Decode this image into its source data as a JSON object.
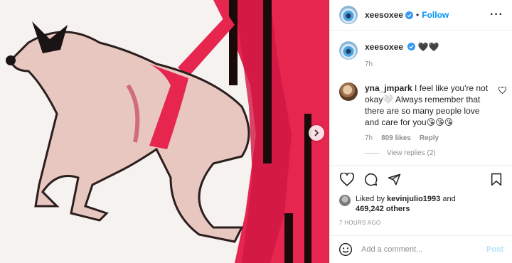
{
  "header": {
    "username": "xeesoxee",
    "separator": "•",
    "follow_label": "Follow",
    "more_label": "···"
  },
  "caption": {
    "username": "xeesoxee",
    "text": "🖤🖤",
    "time": "7h"
  },
  "comment": {
    "username": "yna_jmpark",
    "text": "I feel like you're not okay🤍 Always remember that there are so many people love and care for you😘😘😘",
    "time": "7h",
    "likes": "809 likes",
    "reply_label": "Reply",
    "view_replies": "View replies (2)"
  },
  "likes": {
    "prefix": "Liked by",
    "user": "kevinjulio1993",
    "and": "and",
    "count": "469,242 others"
  },
  "posted_ago": "7 HOURS AGO",
  "add_comment": {
    "placeholder": "Add a comment...",
    "post_label": "Post"
  },
  "colors": {
    "accent": "#0095f6",
    "verified": "#3897f0",
    "post_disabled": "#b2dffc",
    "secondary_text": "#8e8e8e"
  },
  "icons": [
    "verified-badge-icon",
    "more-options-icon",
    "heart-icon",
    "comment-icon",
    "share-icon",
    "save-icon",
    "emoji-icon",
    "next-arrow-icon"
  ]
}
